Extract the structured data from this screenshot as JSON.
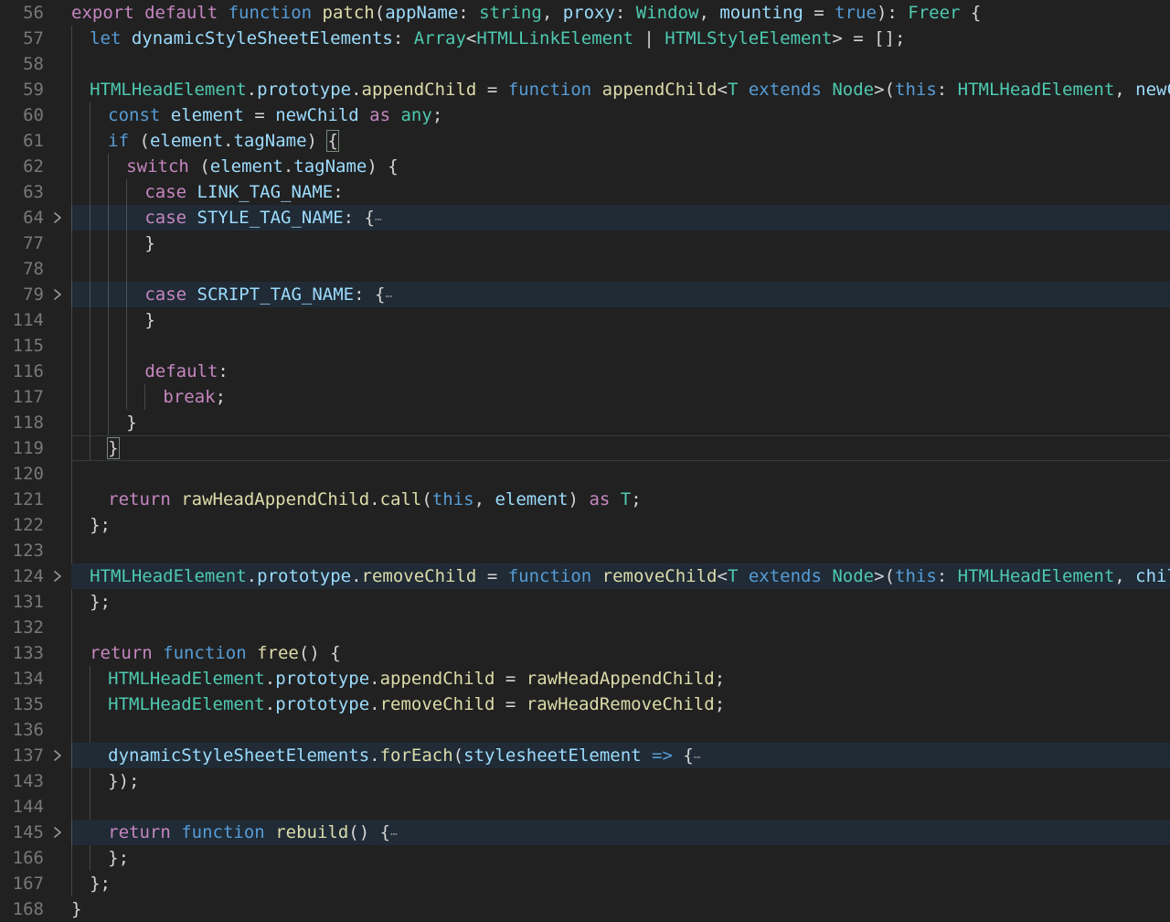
{
  "editor": {
    "name": "code-editor",
    "language": "typescript",
    "theme": "dark-plus",
    "background_color": "#212121",
    "gutter_color": "#787878",
    "folded_line_highlight_color": "#202b36",
    "indent_guide_color": "#474747",
    "first_visible_line": 56,
    "last_visible_line": 168,
    "fold_icon": "chevron-right-icon",
    "folded_placeholder": "⋯",
    "colors": {
      "keyword": "#c586c0",
      "control": "#569cd6",
      "function": "#dcdcaa",
      "type": "#4ec9b0",
      "variable": "#9cdcfe",
      "punctuation": "#d4d4d4",
      "fold_dots": "#8a8a8a"
    },
    "lines": [
      {
        "n": "56",
        "indent": 0,
        "folded": false,
        "fold": false,
        "current": false,
        "guides": 0
      },
      {
        "n": "57",
        "indent": 1,
        "folded": false,
        "fold": false,
        "current": false,
        "guides": 1
      },
      {
        "n": "58",
        "indent": 1,
        "folded": false,
        "fold": false,
        "current": false,
        "guides": 1
      },
      {
        "n": "59",
        "indent": 1,
        "folded": false,
        "fold": false,
        "current": false,
        "guides": 1
      },
      {
        "n": "60",
        "indent": 2,
        "folded": false,
        "fold": false,
        "current": false,
        "guides": 2
      },
      {
        "n": "61",
        "indent": 2,
        "folded": false,
        "fold": false,
        "current": false,
        "guides": 2
      },
      {
        "n": "62",
        "indent": 3,
        "folded": false,
        "fold": false,
        "current": false,
        "guides": 3
      },
      {
        "n": "63",
        "indent": 4,
        "folded": false,
        "fold": false,
        "current": false,
        "guides": 4
      },
      {
        "n": "64",
        "indent": 4,
        "folded": true,
        "fold": true,
        "current": false,
        "guides": 4
      },
      {
        "n": "77",
        "indent": 4,
        "folded": false,
        "fold": false,
        "current": false,
        "guides": 4
      },
      {
        "n": "78",
        "indent": 4,
        "folded": false,
        "fold": false,
        "current": false,
        "guides": 4
      },
      {
        "n": "79",
        "indent": 4,
        "folded": true,
        "fold": true,
        "current": false,
        "guides": 4
      },
      {
        "n": "114",
        "indent": 4,
        "folded": false,
        "fold": false,
        "current": false,
        "guides": 4
      },
      {
        "n": "115",
        "indent": 4,
        "folded": false,
        "fold": false,
        "current": false,
        "guides": 4
      },
      {
        "n": "116",
        "indent": 4,
        "folded": false,
        "fold": false,
        "current": false,
        "guides": 4
      },
      {
        "n": "117",
        "indent": 5,
        "folded": false,
        "fold": false,
        "current": false,
        "guides": 5
      },
      {
        "n": "118",
        "indent": 3,
        "folded": false,
        "fold": false,
        "current": false,
        "guides": 3
      },
      {
        "n": "119",
        "indent": 2,
        "folded": false,
        "fold": false,
        "current": true,
        "guides": 2
      },
      {
        "n": "120",
        "indent": 2,
        "folded": false,
        "fold": false,
        "current": false,
        "guides": 1
      },
      {
        "n": "121",
        "indent": 2,
        "folded": false,
        "fold": false,
        "current": false,
        "guides": 1
      },
      {
        "n": "122",
        "indent": 1,
        "folded": false,
        "fold": false,
        "current": false,
        "guides": 1
      },
      {
        "n": "123",
        "indent": 1,
        "folded": false,
        "fold": false,
        "current": false,
        "guides": 1
      },
      {
        "n": "124",
        "indent": 1,
        "folded": true,
        "fold": true,
        "current": false,
        "guides": 0
      },
      {
        "n": "131",
        "indent": 1,
        "folded": false,
        "fold": false,
        "current": false,
        "guides": 1
      },
      {
        "n": "132",
        "indent": 1,
        "folded": false,
        "fold": false,
        "current": false,
        "guides": 1
      },
      {
        "n": "133",
        "indent": 1,
        "folded": false,
        "fold": false,
        "current": false,
        "guides": 1
      },
      {
        "n": "134",
        "indent": 2,
        "folded": false,
        "fold": false,
        "current": false,
        "guides": 2
      },
      {
        "n": "135",
        "indent": 2,
        "folded": false,
        "fold": false,
        "current": false,
        "guides": 2
      },
      {
        "n": "136",
        "indent": 2,
        "folded": false,
        "fold": false,
        "current": false,
        "guides": 2
      },
      {
        "n": "137",
        "indent": 2,
        "folded": true,
        "fold": true,
        "current": false,
        "guides": 1
      },
      {
        "n": "143",
        "indent": 2,
        "folded": false,
        "fold": false,
        "current": false,
        "guides": 2
      },
      {
        "n": "144",
        "indent": 2,
        "folded": false,
        "fold": false,
        "current": false,
        "guides": 2
      },
      {
        "n": "145",
        "indent": 2,
        "folded": true,
        "fold": true,
        "current": false,
        "guides": 1
      },
      {
        "n": "166",
        "indent": 2,
        "folded": false,
        "fold": false,
        "current": false,
        "guides": 2
      },
      {
        "n": "167",
        "indent": 1,
        "folded": false,
        "fold": false,
        "current": false,
        "guides": 1
      },
      {
        "n": "168",
        "indent": 0,
        "folded": false,
        "fold": false,
        "current": false,
        "guides": 0
      }
    ],
    "source_text": [
      "export default function patch(appName: string, proxy: Window, mounting = true): Freer {",
      "  let dynamicStyleSheetElements: Array<HTMLLinkElement | HTMLStyleElement> = [];",
      "",
      "  HTMLHeadElement.prototype.appendChild = function appendChild<T extends Node>(this: HTMLHeadElement, newChi",
      "    const element = newChild as any;",
      "    if (element.tagName) {",
      "      switch (element.tagName) {",
      "        case LINK_TAG_NAME:",
      "        case STYLE_TAG_NAME: {⋯",
      "        }",
      "",
      "        case SCRIPT_TAG_NAME: {⋯",
      "        }",
      "",
      "        default:",
      "          break;",
      "      }",
      "    }",
      "",
      "    return rawHeadAppendChild.call(this, element) as T;",
      "  };",
      "",
      "  HTMLHeadElement.prototype.removeChild = function removeChild<T extends Node>(this: HTMLHeadElement, child:",
      "  };",
      "",
      "  return function free() {",
      "    HTMLHeadElement.prototype.appendChild = rawHeadAppendChild;",
      "    HTMLHeadElement.prototype.removeChild = rawHeadRemoveChild;",
      "",
      "    dynamicStyleSheetElements.forEach(stylesheetElement => {⋯",
      "    });",
      "",
      "    return function rebuild() {⋯",
      "    };",
      "  };",
      "}"
    ],
    "tokens": [
      [
        [
          "export ",
          "kw"
        ],
        [
          "default ",
          "kw"
        ],
        [
          "function ",
          "kw2"
        ],
        [
          "patch",
          "fn"
        ],
        [
          "(",
          "punc"
        ],
        [
          "appName",
          "var"
        ],
        [
          ": ",
          "punc"
        ],
        [
          "string",
          "type"
        ],
        [
          ", ",
          "punc"
        ],
        [
          "proxy",
          "var"
        ],
        [
          ": ",
          "punc"
        ],
        [
          "Window",
          "type"
        ],
        [
          ", ",
          "punc"
        ],
        [
          "mounting ",
          "var"
        ],
        [
          "= ",
          "punc"
        ],
        [
          "true",
          "kw2"
        ],
        [
          "): ",
          "punc"
        ],
        [
          "Freer",
          "type"
        ],
        [
          " {",
          "punc"
        ]
      ],
      [
        [
          "let ",
          "kw2"
        ],
        [
          "dynamicStyleSheetElements",
          "var"
        ],
        [
          ": ",
          "punc"
        ],
        [
          "Array",
          "type"
        ],
        [
          "<",
          "punc"
        ],
        [
          "HTMLLinkElement",
          "type"
        ],
        [
          " | ",
          "punc"
        ],
        [
          "HTMLStyleElement",
          "type"
        ],
        [
          "> = [];",
          "punc"
        ]
      ],
      [],
      [
        [
          "HTMLHeadElement",
          "type"
        ],
        [
          ".",
          "punc"
        ],
        [
          "prototype",
          "var"
        ],
        [
          ".",
          "punc"
        ],
        [
          "appendChild",
          "fn"
        ],
        [
          " = ",
          "punc"
        ],
        [
          "function ",
          "kw2"
        ],
        [
          "appendChild",
          "fn"
        ],
        [
          "<",
          "punc"
        ],
        [
          "T",
          "type"
        ],
        [
          " extends ",
          "kw2"
        ],
        [
          "Node",
          "type"
        ],
        [
          ">(",
          "punc"
        ],
        [
          "this",
          "kw2"
        ],
        [
          ": ",
          "punc"
        ],
        [
          "HTMLHeadElement",
          "type"
        ],
        [
          ", ",
          "punc"
        ],
        [
          "newChi",
          "var"
        ]
      ],
      [
        [
          "const ",
          "kw2"
        ],
        [
          "element ",
          "var"
        ],
        [
          "= ",
          "punc"
        ],
        [
          "newChild ",
          "var"
        ],
        [
          "as ",
          "kw"
        ],
        [
          "any",
          "type"
        ],
        [
          ";",
          "punc"
        ]
      ],
      [
        [
          "if ",
          "kw2"
        ],
        [
          "(",
          "punc"
        ],
        [
          "element",
          "var"
        ],
        [
          ".",
          "punc"
        ],
        [
          "tagName",
          "var"
        ],
        [
          ") ",
          "punc"
        ],
        [
          "{",
          "bmatch"
        ]
      ],
      [
        [
          "switch ",
          "kw"
        ],
        [
          "(",
          "punc"
        ],
        [
          "element",
          "var"
        ],
        [
          ".",
          "punc"
        ],
        [
          "tagName",
          "var"
        ],
        [
          ") {",
          "punc"
        ]
      ],
      [
        [
          "case ",
          "kw"
        ],
        [
          "LINK_TAG_NAME",
          "const"
        ],
        [
          ":",
          "punc"
        ]
      ],
      [
        [
          "case ",
          "kw"
        ],
        [
          "STYLE_TAG_NAME",
          "const"
        ],
        [
          ": {",
          "punc"
        ],
        [
          "⋯",
          "dots"
        ]
      ],
      [
        [
          "}",
          "punc"
        ]
      ],
      [],
      [
        [
          "case ",
          "kw"
        ],
        [
          "SCRIPT_TAG_NAME",
          "const"
        ],
        [
          ": {",
          "punc"
        ],
        [
          "⋯",
          "dots"
        ]
      ],
      [
        [
          "}",
          "punc"
        ]
      ],
      [],
      [
        [
          "default",
          "kw"
        ],
        [
          ":",
          "punc"
        ]
      ],
      [
        [
          "break",
          "kw"
        ],
        [
          ";",
          "punc"
        ]
      ],
      [
        [
          "}",
          "punc"
        ]
      ],
      [
        [
          "}",
          "bmatch"
        ]
      ],
      [],
      [
        [
          "return ",
          "kw"
        ],
        [
          "rawHeadAppendChild",
          "fn"
        ],
        [
          ".",
          "punc"
        ],
        [
          "call",
          "fn"
        ],
        [
          "(",
          "punc"
        ],
        [
          "this",
          "kw2"
        ],
        [
          ", ",
          "punc"
        ],
        [
          "element",
          "var"
        ],
        [
          ") ",
          "punc"
        ],
        [
          "as ",
          "kw"
        ],
        [
          "T",
          "type"
        ],
        [
          ";",
          "punc"
        ]
      ],
      [
        [
          "};",
          "punc"
        ]
      ],
      [],
      [
        [
          "HTMLHeadElement",
          "type"
        ],
        [
          ".",
          "punc"
        ],
        [
          "prototype",
          "var"
        ],
        [
          ".",
          "punc"
        ],
        [
          "removeChild",
          "fn"
        ],
        [
          " = ",
          "punc"
        ],
        [
          "function ",
          "kw2"
        ],
        [
          "removeChild",
          "fn"
        ],
        [
          "<",
          "punc"
        ],
        [
          "T",
          "type"
        ],
        [
          " extends ",
          "kw2"
        ],
        [
          "Node",
          "type"
        ],
        [
          ">(",
          "punc"
        ],
        [
          "this",
          "kw2"
        ],
        [
          ": ",
          "punc"
        ],
        [
          "HTMLHeadElement",
          "type"
        ],
        [
          ", ",
          "punc"
        ],
        [
          "child:",
          "var"
        ]
      ],
      [
        [
          "};",
          "punc"
        ]
      ],
      [],
      [
        [
          "return ",
          "kw"
        ],
        [
          "function ",
          "kw2"
        ],
        [
          "free",
          "fn"
        ],
        [
          "() {",
          "punc"
        ]
      ],
      [
        [
          "HTMLHeadElement",
          "type"
        ],
        [
          ".",
          "punc"
        ],
        [
          "prototype",
          "var"
        ],
        [
          ".",
          "punc"
        ],
        [
          "appendChild",
          "fn"
        ],
        [
          " = ",
          "punc"
        ],
        [
          "rawHeadAppendChild",
          "fn"
        ],
        [
          ";",
          "punc"
        ]
      ],
      [
        [
          "HTMLHeadElement",
          "type"
        ],
        [
          ".",
          "punc"
        ],
        [
          "prototype",
          "var"
        ],
        [
          ".",
          "punc"
        ],
        [
          "removeChild",
          "fn"
        ],
        [
          " = ",
          "punc"
        ],
        [
          "rawHeadRemoveChild",
          "fn"
        ],
        [
          ";",
          "punc"
        ]
      ],
      [],
      [
        [
          "dynamicStyleSheetElements",
          "var"
        ],
        [
          ".",
          "punc"
        ],
        [
          "forEach",
          "fn"
        ],
        [
          "(",
          "punc"
        ],
        [
          "stylesheetElement ",
          "var"
        ],
        [
          "=> ",
          "kw2"
        ],
        [
          "{",
          "punc"
        ],
        [
          "⋯",
          "dots"
        ]
      ],
      [
        [
          "});",
          "punc"
        ]
      ],
      [],
      [
        [
          "return ",
          "kw"
        ],
        [
          "function ",
          "kw2"
        ],
        [
          "rebuild",
          "fn"
        ],
        [
          "() {",
          "punc"
        ],
        [
          "⋯",
          "dots"
        ]
      ],
      [
        [
          "};",
          "punc"
        ]
      ],
      [
        [
          "};",
          "punc"
        ]
      ],
      [
        [
          "}",
          "punc"
        ]
      ]
    ]
  }
}
